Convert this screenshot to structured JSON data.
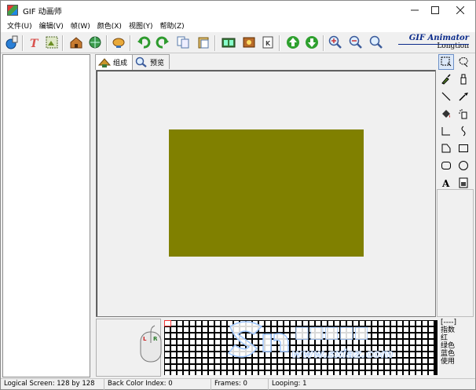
{
  "window": {
    "title": "GIF 动画师",
    "controls": [
      "minimize",
      "maximize",
      "close"
    ]
  },
  "menu": {
    "items": [
      "文件(U)",
      "编辑(V)",
      "帧(W)",
      "颜色(X)",
      "视图(Y)",
      "帮助(Z)"
    ]
  },
  "toolbar": {
    "icons": [
      "open-wizard-icon",
      "text-icon",
      "image-icon",
      "home-icon",
      "globe-icon",
      "lamp-icon",
      "undo-icon",
      "redo-icon",
      "copy-icon",
      "paste-icon",
      "frames-icon",
      "insert-frame-icon",
      "frame-edit-icon",
      "move-up-icon",
      "move-down-icon",
      "zoom-in-icon",
      "zoom-out-icon",
      "zoom-fit-icon"
    ],
    "brand_title": "GIF Animator",
    "brand_sub": "Longtion"
  },
  "tabs": [
    {
      "label": "组成",
      "icon": "compose-icon",
      "active": true
    },
    {
      "label": "预览",
      "icon": "magnifier-icon",
      "active": false
    }
  ],
  "canvas": {
    "frame_color": "#808000"
  },
  "tools": [
    "rect-select-icon",
    "lasso-icon",
    "brush-icon",
    "bottle-icon",
    "line-icon",
    "eyedropper-icon",
    "fill-icon",
    "spray-icon",
    "polyline-icon",
    "curve-icon",
    "polygon-icon",
    "rectangle-icon",
    "rounded-rect-icon",
    "ellipse-icon",
    "text-tool-icon",
    "eraser-icon"
  ],
  "mouse": {
    "left_label": "L",
    "right_label": "R"
  },
  "color_info": {
    "lines": [
      "[----]",
      "指数",
      "红",
      "绿色",
      "蓝色",
      "使用"
    ]
  },
  "watermark": {
    "text": "www.sxiaz.com"
  },
  "status": {
    "logical_screen": "Logical Screen: 128 by 128",
    "back_color": "Back Color Index: 0",
    "frames": "Frames: 0",
    "looping": "Looping: 1"
  }
}
